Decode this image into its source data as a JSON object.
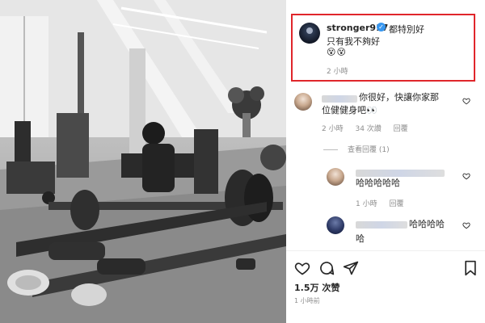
{
  "post": {
    "username": "stronger917",
    "caption_line1": "都特別好",
    "caption_line2": "只有我不夠好",
    "caption_emoji": "😵😵",
    "time": "2 小時"
  },
  "comments": [
    {
      "text_line1": "你很好，快讓你家那",
      "text_line2": "位健健身吧👀",
      "time": "2 小時",
      "likes": "34 次讚",
      "reply": "回覆"
    }
  ],
  "view_replies": "查看回覆 (1)",
  "replies": [
    {
      "text": "哈哈哈哈哈",
      "time": "1 小時",
      "reply": "回覆"
    },
    {
      "text_line1": "哈哈哈哈",
      "text_line2": "哈"
    }
  ],
  "footer": {
    "likes": "1.5万 次赞",
    "posted": "1 小時前"
  },
  "icons": {
    "like": "heart-icon",
    "comment": "comment-icon",
    "share": "share-icon",
    "save": "bookmark-icon",
    "verified": "verified-badge-icon"
  },
  "colors": {
    "highlight_border": "#e0262b",
    "verified": "#3897f0",
    "muted_text": "#8e8e8e"
  }
}
